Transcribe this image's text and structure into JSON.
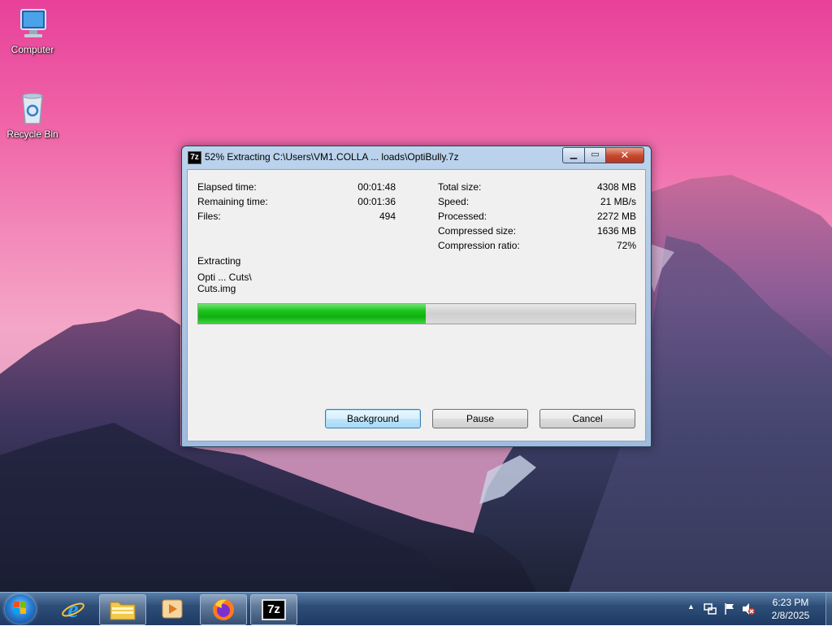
{
  "desktop": {
    "icons": [
      {
        "label": "Computer",
        "icon": "computer-icon"
      },
      {
        "label": "Recycle Bin",
        "icon": "recycle-bin-icon"
      }
    ]
  },
  "window": {
    "title": "52% Extracting C:\\Users\\VM1.COLLA ... loads\\OptiBully.7z",
    "app_icon_text": "7z",
    "left_stats": [
      {
        "label": "Elapsed time:",
        "value": "00:01:48"
      },
      {
        "label": "Remaining time:",
        "value": "00:01:36"
      },
      {
        "label": "Files:",
        "value": "494"
      }
    ],
    "right_stats": [
      {
        "label": "Total size:",
        "value": "4308 MB"
      },
      {
        "label": "Speed:",
        "value": "21 MB/s"
      },
      {
        "label": "Processed:",
        "value": "2272 MB"
      },
      {
        "label": "Compressed size:",
        "value": "1636 MB"
      },
      {
        "label": "Compression ratio:",
        "value": "72%"
      }
    ],
    "operation": "Extracting",
    "current_path": "Opti ... Cuts\\",
    "current_file": "Cuts.img",
    "progress_percent": 52,
    "buttons": {
      "background": "Background",
      "pause": "Pause",
      "cancel": "Cancel"
    }
  },
  "taskbar": {
    "pinned": [
      {
        "name": "internet-explorer-icon"
      },
      {
        "name": "file-explorer-icon"
      },
      {
        "name": "media-player-icon"
      },
      {
        "name": "firefox-icon"
      },
      {
        "name": "7zip-icon",
        "text": "7z",
        "active": true
      }
    ],
    "clock_time": "6:23 PM",
    "clock_date": "2/8/2025"
  }
}
